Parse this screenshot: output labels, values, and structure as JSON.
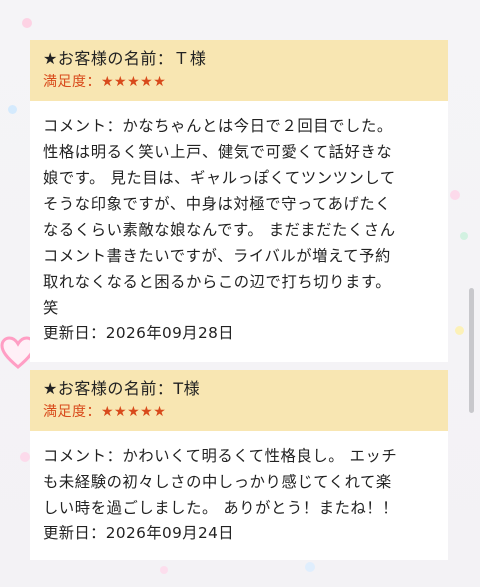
{
  "reviews": [
    {
      "customer_label": "★お客様の名前：Ｔ様",
      "satisfaction_label": "満足度：",
      "stars": "★★★★★",
      "rating": 5,
      "comment_lines": [
        "コメント：かなちゃんとは今日で２回目でした。",
        "性格は明るく笑い上戸、健気で可愛くて話好きな",
        "娘です。 見た目は、ギャルっぽくてツンツンして",
        "そうな印象ですが、中身は対極で守ってあげたく",
        "なるくらい素敵な娘なんです。 まだまだたくさん",
        "コメント書きたいですが、ライバルが増えて予約",
        "取れなくなると困るからこの辺で打ち切ります。",
        "笑"
      ],
      "updated": "更新日：2026年09月28日"
    },
    {
      "customer_label": "★お客様の名前：T様",
      "satisfaction_label": "満足度：",
      "stars": "★★★★★",
      "rating": 5,
      "comment_lines": [
        "コメント：かわいくて明るくて性格良し。 エッチ",
        "も未経験の初々しさの中しっかり感じてくれて楽",
        "しい時を過ごしました。 ありがとう！またね！！"
      ],
      "updated": "更新日：2026年09月24日"
    }
  ],
  "colors": {
    "header_bg": "#f8e6b2",
    "stars": "#d84a1b",
    "text": "#222222",
    "heart": "#ff9ec4"
  }
}
